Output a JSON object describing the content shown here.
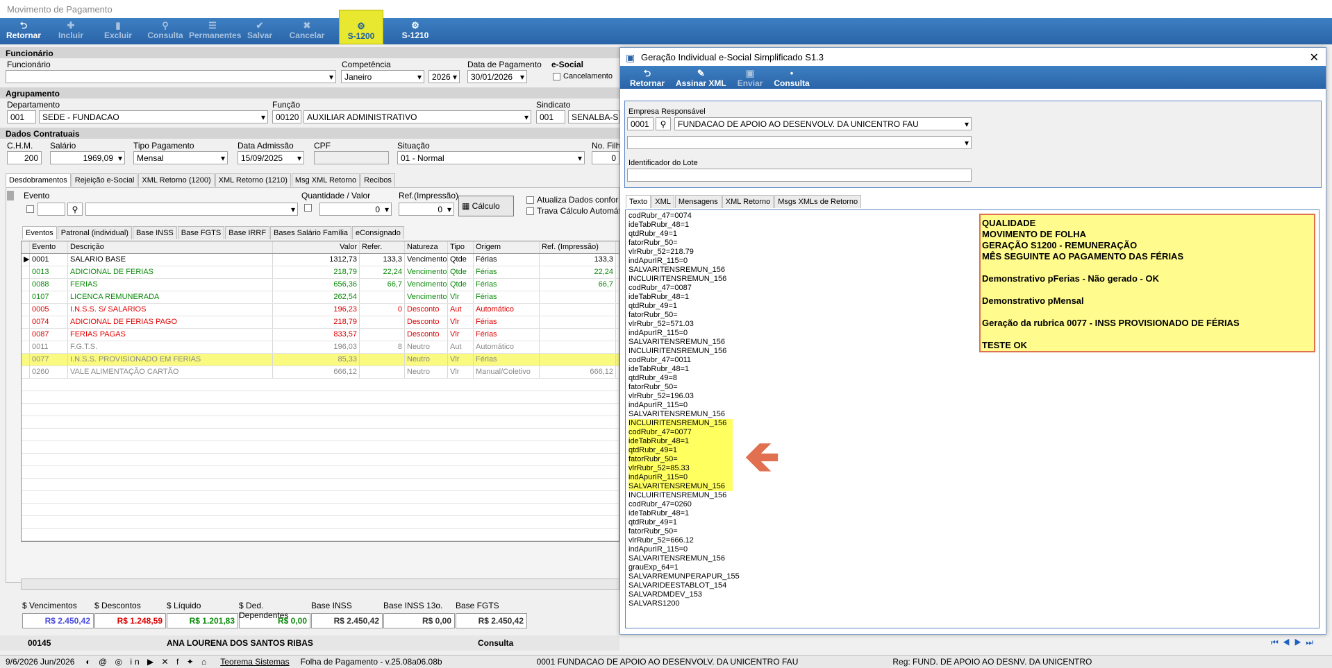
{
  "app": {
    "title": "Movimento de Pagamento"
  },
  "toolbar": [
    {
      "label": "Retornar",
      "icon": "undo-icon",
      "glyph": "⮌",
      "dim": false,
      "hl": false
    },
    {
      "label": "Incluir",
      "icon": "plus-icon",
      "glyph": "✚",
      "dim": true,
      "hl": false
    },
    {
      "label": "Excluir",
      "icon": "trash-icon",
      "glyph": "▮",
      "dim": true,
      "hl": false
    },
    {
      "label": "Consulta",
      "icon": "search-icon",
      "glyph": "⚲",
      "dim": true,
      "hl": false
    },
    {
      "label": "Permanentes",
      "icon": "list-icon",
      "glyph": "☰",
      "dim": true,
      "hl": false
    },
    {
      "label": "Salvar",
      "icon": "check-icon",
      "glyph": "✔",
      "dim": true,
      "hl": false
    },
    {
      "label": "Cancelar",
      "icon": "cancel-icon",
      "glyph": "✖",
      "dim": true,
      "hl": false
    },
    {
      "label": "S-1200",
      "icon": "esocial-icon",
      "glyph": "⚙",
      "dim": false,
      "hl": true
    },
    {
      "label": "S-1210",
      "icon": "esocial-icon",
      "glyph": "⚙",
      "dim": false,
      "hl": false
    }
  ],
  "funcionario": {
    "section": "Funcionário",
    "label": "Funcionário",
    "competencia_label": "Competência",
    "competencia": "Janeiro",
    "ano": "2026",
    "data_pag_label": "Data de Pagamento",
    "data_pag": "30/01/2026",
    "esocial_label": "e-Social",
    "cancelamento": "Cancelamento"
  },
  "agrupamento": {
    "section": "Agrupamento",
    "dep_label": "Departamento",
    "dep_cod": "001",
    "dep": "SEDE - FUNDACAO",
    "func_label": "Função",
    "func_cod": "00120",
    "func": "AUXILIAR ADMINISTRATIVO",
    "sind_label": "Sindicato",
    "sind_cod": "001",
    "sind": "SENALBA-SIN"
  },
  "contratuais": {
    "section": "Dados Contratuais",
    "chm_label": "C.H.M.",
    "chm": "200",
    "sal_label": "Salário",
    "sal": "1969,09",
    "tipo_label": "Tipo Pagamento",
    "tipo": "Mensal",
    "adm_label": "Data Admissão",
    "adm": "15/09/2025",
    "cpf_label": "CPF",
    "sit_label": "Situação",
    "sit": "01 - Normal",
    "filhos_label": "No. Filh",
    "filhos": "0"
  },
  "tabs1": [
    "Desdobramentos",
    "Rejeição e-Social",
    "XML Retorno (1200)",
    "XML Retorno (1210)",
    "Msg XML Retorno",
    "Recibos"
  ],
  "evento": {
    "evento_label": "Evento",
    "qtd_label": "Quantidade / Valor",
    "qtd": "0",
    "ref_label": "Ref.(Impressão)",
    "ref": "0",
    "calculo": "Cálculo",
    "atualiza": "Atualiza Dados confor",
    "trava": "Trava Cálculo Automát"
  },
  "tabs2": [
    "Eventos",
    "Patronal (individual)",
    "Base INSS",
    "Base FGTS",
    "Base IRRF",
    "Bases Salário Família",
    "eConsignado"
  ],
  "grid": {
    "headers": [
      "",
      "Evento",
      "Descrição",
      "Valor",
      "Refer.",
      "Natureza",
      "Tipo",
      "Origem",
      "Ref. (Impressão)"
    ],
    "rows": [
      {
        "cls": "",
        "mark": "▶",
        "c": [
          "0001",
          "SALARIO BASE",
          "1312,73",
          "133,3",
          "Vencimento",
          "Qtde",
          "Férias",
          "133,3"
        ]
      },
      {
        "cls": "green",
        "mark": "",
        "c": [
          "0013",
          "ADICIONAL DE FERIAS",
          "218,79",
          "22,24",
          "Vencimento",
          "Qtde",
          "Férias",
          "22,24"
        ]
      },
      {
        "cls": "green",
        "mark": "",
        "c": [
          "0088",
          "FERIAS",
          "656,36",
          "66,7",
          "Vencimento",
          "Qtde",
          "Férias",
          "66,7"
        ]
      },
      {
        "cls": "green",
        "mark": "",
        "c": [
          "0107",
          "LICENCA REMUNERADA",
          "262,54",
          "",
          "Vencimento",
          "Vlr",
          "Férias",
          ""
        ]
      },
      {
        "cls": "red",
        "mark": "",
        "c": [
          "0005",
          "I.N.S.S. S/ SALARIOS",
          "196,23",
          "0",
          "Desconto",
          "Aut",
          "Automático",
          ""
        ]
      },
      {
        "cls": "red",
        "mark": "",
        "c": [
          "0074",
          "ADICIONAL DE FERIAS PAGO",
          "218,79",
          "",
          "Desconto",
          "Vlr",
          "Férias",
          ""
        ]
      },
      {
        "cls": "red",
        "mark": "",
        "c": [
          "0087",
          "FERIAS PAGAS",
          "833,57",
          "",
          "Desconto",
          "Vlr",
          "Férias",
          ""
        ]
      },
      {
        "cls": "gray",
        "mark": "",
        "c": [
          "0011",
          "F.G.T.S.",
          "196,03",
          "8",
          "Neutro",
          "Aut",
          "Automático",
          ""
        ]
      },
      {
        "cls": "gray hlrow",
        "mark": "",
        "c": [
          "0077",
          "I.N.S.S. PROVISIONADO EM FERIAS",
          "85,33",
          "",
          "Neutro",
          "Vlr",
          "Férias",
          ""
        ]
      },
      {
        "cls": "gray",
        "mark": "",
        "c": [
          "0260",
          "VALE ALIMENTAÇÃO CARTÃO",
          "666,12",
          "",
          "Neutro",
          "Vlr",
          "Manual/Coletivo",
          "666,12"
        ]
      }
    ]
  },
  "totals": [
    {
      "label": "$ Vencimentos",
      "value": "R$ 2.450,42",
      "color": "#4a4adf"
    },
    {
      "label": "$ Descontos",
      "value": "R$ 1.248,59",
      "color": "#e00000"
    },
    {
      "label": "$ Líquido",
      "value": "R$ 1.201,83",
      "color": "#0a8a0a"
    },
    {
      "label": "$ Ded. Dependentes",
      "value": "R$ 0,00",
      "color": "#0a8a0a"
    },
    {
      "label": "Base INSS",
      "value": "R$ 2.450,42",
      "color": "#333"
    },
    {
      "label": "Base INSS 13o.",
      "value": "R$ 0,00",
      "color": "#333"
    },
    {
      "label": "Base FGTS",
      "value": "R$ 2.450,42",
      "color": "#333"
    }
  ],
  "footer": {
    "code": "00145",
    "name": "ANA LOURENA DOS SANTOS RIBAS",
    "mode": "Consulta"
  },
  "statusbar": {
    "date": "9/6/2026 Jun/2026",
    "company_link": "Teorema Sistemas",
    "version": "Folha de Pagamento - v.25.08a06.08b",
    "empresa": "0001 FUNDACAO DE APOIO AO DESENVOLV. DA UNICENTRO FAU",
    "reg": "Reg: FUND. DE APOIO AO DESNV. DA UNICENTRO"
  },
  "dialog": {
    "title": "Geração Individual e-Social Simplificado S1.3",
    "toolbar": [
      {
        "label": "Retornar",
        "glyph": "⮌",
        "dim": false
      },
      {
        "label": "Assinar XML",
        "glyph": "✎",
        "dim": false
      },
      {
        "label": "Enviar",
        "glyph": "▣",
        "dim": true
      },
      {
        "label": "Consulta",
        "glyph": "•",
        "dim": false
      }
    ],
    "empresa_label": "Empresa Responsável",
    "empresa_cod": "0001",
    "empresa": "FUNDACAO DE APOIO AO DESENVOLV. DA UNICENTRO FAU",
    "lote_label": "Identificador do Lote",
    "tabs": [
      "Texto",
      "XML",
      "Mensagens",
      "XML Retorno",
      "Msgs XMLs de Retorno"
    ],
    "lines": [
      "codRubr_47=0074",
      "ideTabRubr_48=1",
      "qtdRubr_49=1",
      "fatorRubr_50=",
      "vlrRubr_52=218.79",
      "indApurIR_115=0",
      "SALVARITENSREMUN_156",
      "INCLUIRITENSREMUN_156",
      "codRubr_47=0087",
      "ideTabRubr_48=1",
      "qtdRubr_49=1",
      "fatorRubr_50=",
      "vlrRubr_52=571.03",
      "indApurIR_115=0",
      "SALVARITENSREMUN_156",
      "INCLUIRITENSREMUN_156",
      "codRubr_47=0011",
      "ideTabRubr_48=1",
      "qtdRubr_49=8",
      "fatorRubr_50=",
      "vlrRubr_52=196.03",
      "indApurIR_115=0",
      "SALVARITENSREMUN_156",
      "INCLUIRITENSREMUN_156",
      "codRubr_47=0077",
      "ideTabRubr_48=1",
      "qtdRubr_49=1",
      "fatorRubr_50=",
      "vlrRubr_52=85.33",
      "indApurIR_115=0",
      "SALVARITENSREMUN_156",
      "INCLUIRITENSREMUN_156",
      "codRubr_47=0260",
      "ideTabRubr_48=1",
      "qtdRubr_49=1",
      "fatorRubr_50=",
      "vlrRubr_52=666.12",
      "indApurIR_115=0",
      "SALVARITENSREMUN_156",
      "grauExp_64=1",
      "SALVARREMUNPERAPUR_155",
      "SALVARIDEESTABLOT_154",
      "SALVARDMDEV_153",
      "SALVARS1200"
    ],
    "highlight_from": 23,
    "highlight_to": 30,
    "note": [
      "QUALIDADE",
      "MOVIMENTO DE FOLHA",
      "GERAÇÃO S1200 - REMUNERAÇÃO",
      "MÊS SEGUINTE AO PAGAMENTO DAS FÉRIAS",
      "",
      "Demonstrativo pFerias - Não gerado - OK",
      "",
      "Demonstrativo pMensal",
      "",
      "Geração da rubrica 0077 - INSS PROVISIONADO DE FÉRIAS",
      "",
      "TESTE OK"
    ]
  }
}
